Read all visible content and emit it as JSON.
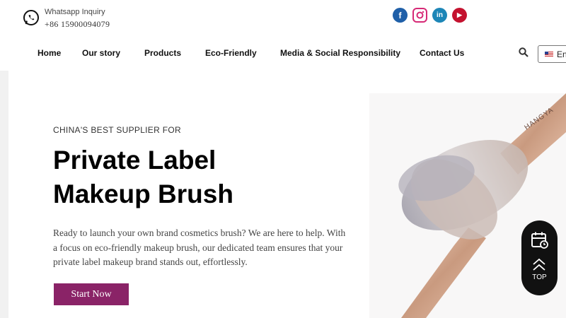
{
  "topbar": {
    "whatsapp_label": "Whatsapp Inquiry",
    "phone": "+86 15900094079",
    "social": [
      {
        "name": "facebook-icon",
        "glyph": "f"
      },
      {
        "name": "instagram-icon",
        "glyph": ""
      },
      {
        "name": "linkedin-icon",
        "glyph": "in"
      },
      {
        "name": "youtube-icon",
        "glyph": "▶"
      }
    ]
  },
  "nav": {
    "items": [
      "Home",
      "Our story",
      "Products",
      "Eco-Friendly",
      "Media & Social Responsibility",
      "Contact Us"
    ],
    "language": "En"
  },
  "hero": {
    "eyebrow": "CHINA'S BEST SUPPLIER FOR",
    "headline_line1": "Private Label",
    "headline_line2": "Makeup Brush",
    "description": "Ready to launch your own brand cosmetics brush? We are here to help. With a focus on eco-friendly makeup brush, our dedicated team ensures that your private label makeup brand stands out, effortlessly.",
    "cta_label": "Start Now",
    "brush_text": "HANGYA"
  },
  "float_panel": {
    "top_label": "TOP"
  },
  "colors": {
    "cta": "#8a2367",
    "float_panel": "#111111",
    "facebook": "#1f5fa8",
    "linkedin": "#1d86b7",
    "youtube": "#c4122f"
  }
}
